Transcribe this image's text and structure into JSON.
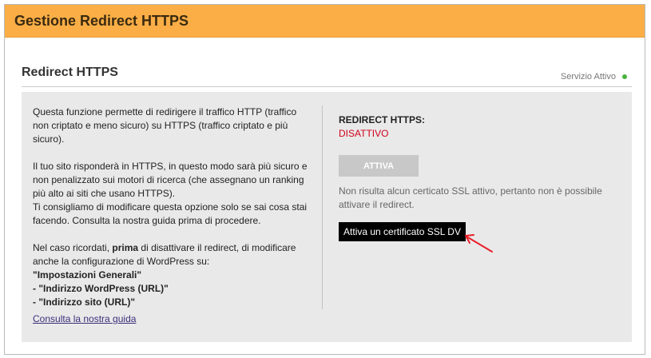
{
  "header": {
    "title": "Gestione Redirect HTTPS"
  },
  "section": {
    "title": "Redirect HTTPS",
    "service_status": "Servizio Attivo"
  },
  "info": {
    "p1": "Questa funzione permette di redirigere il traffico HTTP (traffico non criptato e meno sicuro) su HTTPS (traffico criptato e più sicuro).",
    "p2": "Il tuo sito risponderà in HTTPS, in questo modo sarà più sicuro e non penalizzato sui motori di ricerca (che assegnano un ranking più alto ai siti che usano HTTPS).",
    "p3": "Ti consigliamo di modificare questa opzione solo se sai cosa stai facendo. Consulta la nostra guida prima di procedere.",
    "p4_before": "Nel caso ricordati, ",
    "p4_bold": "prima",
    "p4_after": " di disattivare il redirect, di modificare anche la configurazione di WordPress su:",
    "settings_items": [
      "\"Impostazioni Generali\"",
      "- \"Indirizzo WordPress (URL)\"",
      "- \"Indirizzo sito (URL)\""
    ],
    "guide_link": "Consulta la nostra guida"
  },
  "redirect": {
    "label": "REDIRECT HTTPS:",
    "state": "DISATTIVO",
    "activate_label": "ATTIVA",
    "ssl_note": "Non risulta alcun certicato SSL attivo, pertanto non è possibile attivare il redirect.",
    "ssl_button_label": "Attiva un certificato SSL DV"
  },
  "colors": {
    "header_bg": "#fbae46",
    "status_dot": "#49b23d",
    "state_red": "#d0021b",
    "arrow_red": "#e8202a"
  }
}
